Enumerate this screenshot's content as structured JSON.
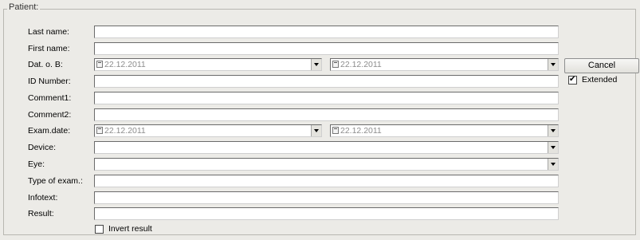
{
  "group": {
    "title": "Patient:"
  },
  "fields": {
    "last_name": {
      "label": "Last name:",
      "value": ""
    },
    "first_name": {
      "label": "First name:",
      "value": ""
    },
    "dob": {
      "label": "Dat. o. B:",
      "from": "22.12.2011",
      "to": "22.12.2011"
    },
    "id_number": {
      "label": "ID Number:",
      "value": ""
    },
    "comment1": {
      "label": "Comment1:",
      "value": ""
    },
    "comment2": {
      "label": "Comment2:",
      "value": ""
    },
    "exam_date": {
      "label": "Exam.date:",
      "from": "22.12.2011",
      "to": "22.12.2011"
    },
    "device": {
      "label": "Device:",
      "value": ""
    },
    "eye": {
      "label": "Eye:",
      "value": ""
    },
    "type_of_exam": {
      "label": "Type of exam.:",
      "value": ""
    },
    "infotext": {
      "label": "Infotext:",
      "value": ""
    },
    "result": {
      "label": "Result:",
      "value": ""
    }
  },
  "buttons": {
    "cancel": "Cancel"
  },
  "checkboxes": {
    "extended": {
      "label": "Extended",
      "checked": true
    },
    "invert_result": {
      "label": "Invert result",
      "checked": false
    }
  }
}
